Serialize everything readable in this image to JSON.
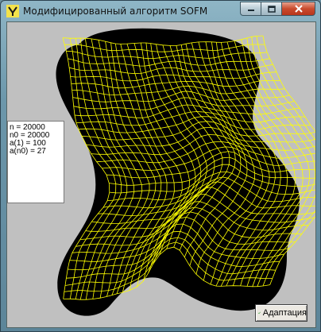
{
  "window": {
    "title": "Модифицированный алгоритм SOFM"
  },
  "info_panel": {
    "lines": [
      "n = 20000",
      "n0 = 20000",
      "a(1) = 100",
      "a(n0) = 27"
    ]
  },
  "adapt_button": {
    "label": "Адаптация",
    "icon": "checkmark-icon"
  },
  "colors": {
    "background": "#c0c0c0",
    "region": "#000000",
    "grid": "#ffff00",
    "checkmark": "#2a9a2a"
  }
}
